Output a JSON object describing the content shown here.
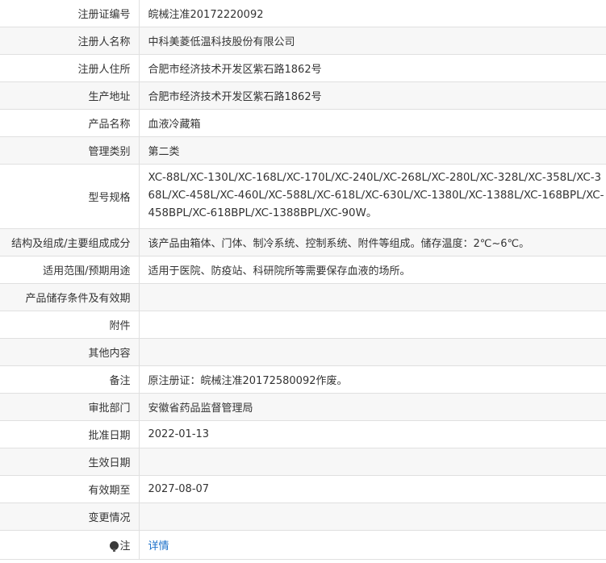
{
  "rows": [
    {
      "label": "注册证编号",
      "value": "皖械注准20172220092"
    },
    {
      "label": "注册人名称",
      "value": "中科美菱低温科技股份有限公司"
    },
    {
      "label": "注册人住所",
      "value": "合肥市经济技术开发区紫石路1862号"
    },
    {
      "label": "生产地址",
      "value": "合肥市经济技术开发区紫石路1862号"
    },
    {
      "label": "产品名称",
      "value": "血液冷藏箱"
    },
    {
      "label": "管理类别",
      "value": "第二类"
    },
    {
      "label": "型号规格",
      "value": "XC-88L/XC-130L/XC-168L/XC-170L/XC-240L/XC-268L/XC-280L/XC-328L/XC-358L/XC-368L/XC-458L/XC-460L/XC-588L/XC-618L/XC-630L/XC-1380L/XC-1388L/XC-168BPL/XC-458BPL/XC-618BPL/XC-1388BPL/XC-90W。"
    },
    {
      "label": "结构及组成/主要组成成分",
      "value": "该产品由箱体、门体、制冷系统、控制系统、附件等组成。储存温度：2℃~6℃。"
    },
    {
      "label": "适用范围/预期用途",
      "value": "适用于医院、防疫站、科研院所等需要保存血液的场所。"
    },
    {
      "label": "产品储存条件及有效期",
      "value": ""
    },
    {
      "label": "附件",
      "value": ""
    },
    {
      "label": "其他内容",
      "value": ""
    },
    {
      "label": "备注",
      "value": "原注册证：皖械注准20172580092作废。"
    },
    {
      "label": "审批部门",
      "value": "安徽省药品监督管理局"
    },
    {
      "label": "批准日期",
      "value": "2022-01-13"
    },
    {
      "label": "生效日期",
      "value": ""
    },
    {
      "label": "有效期至",
      "value": "2027-08-07"
    },
    {
      "label": "变更情况",
      "value": ""
    }
  ],
  "note": {
    "label": "注",
    "link_text": "详情",
    "icon": "info-pin-icon"
  }
}
